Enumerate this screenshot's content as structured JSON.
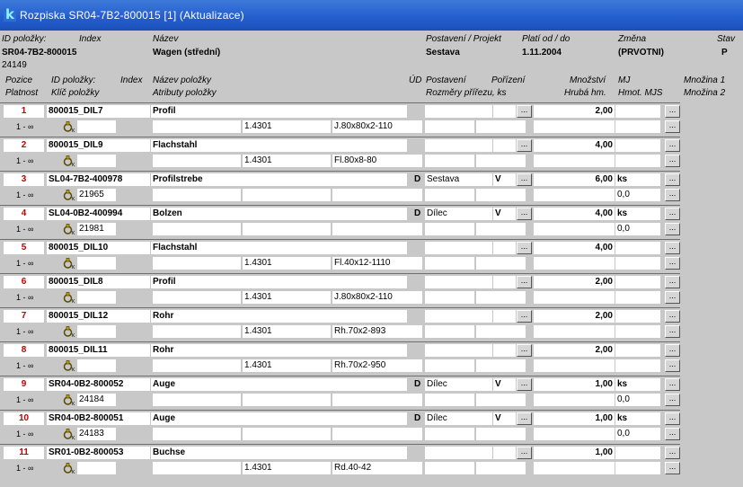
{
  "window": {
    "icon": "k",
    "title": "Rozpiska SR04-7B2-800015 [1] (Aktualizace)"
  },
  "header": {
    "labels": {
      "id": "ID položky:",
      "index": "Index",
      "name": "Název",
      "postaveni": "Postavení / Projekt",
      "platnost": "Platí od / do",
      "zmena": "Změna",
      "stav": "Stav"
    },
    "values": {
      "id": "SR04-7B2-800015",
      "num": "24149",
      "name": "Wagen (střední)",
      "postaveni": "Sestava",
      "date": "1.11.2004",
      "zmena": "(PRVOTNI)",
      "stav": "P"
    }
  },
  "columns": {
    "pozice": "Pozice",
    "platnost": "Platnost",
    "id": "ID položky:",
    "klic": "Klíč položky",
    "index": "Index",
    "nazev": "Název položky",
    "atributy": "Atributy položky",
    "ud": "ÚD",
    "postaveni": "Postavení",
    "rozmery": "Rozměry přířezu, ks",
    "porizeni": "Pořízení",
    "mnozstvi": "Množství",
    "hruba": "Hrubá hm.",
    "mj": "MJ",
    "hmot": "Hmot. MJS",
    "mnozina1": "Množina 1",
    "mnozina2": "Množina 2"
  },
  "button_label": "...",
  "items": [
    {
      "pos": "1",
      "validity": "1 - ∞",
      "id": "800015_DIL7",
      "name": "Profil",
      "ud": "",
      "postaveni": "",
      "porizeni": "",
      "qty": "2,00",
      "mj": "",
      "key": "",
      "material": "1.4301",
      "dim": "J.80x80x2-110",
      "hmot": ""
    },
    {
      "pos": "2",
      "validity": "1 - ∞",
      "id": "800015_DIL9",
      "name": "Flachstahl",
      "ud": "",
      "postaveni": "",
      "porizeni": "",
      "qty": "4,00",
      "mj": "",
      "key": "",
      "material": "1.4301",
      "dim": "Fl.80x8-80",
      "hmot": ""
    },
    {
      "pos": "3",
      "validity": "1 - ∞",
      "id": "SL04-7B2-400978",
      "name": "Profilstrebe",
      "ud": "D",
      "postaveni": "Sestava",
      "porizeni": "V",
      "qty": "6,00",
      "mj": "ks",
      "key": "21965",
      "material": "",
      "dim": "",
      "hmot": "0,0"
    },
    {
      "pos": "4",
      "validity": "1 - ∞",
      "id": "SL04-0B2-400994",
      "name": "Bolzen",
      "ud": "D",
      "postaveni": "Dílec",
      "porizeni": "V",
      "qty": "4,00",
      "mj": "ks",
      "key": "21981",
      "material": "",
      "dim": "",
      "hmot": "0,0"
    },
    {
      "pos": "5",
      "validity": "1 - ∞",
      "id": "800015_DIL10",
      "name": "Flachstahl",
      "ud": "",
      "postaveni": "",
      "porizeni": "",
      "qty": "4,00",
      "mj": "",
      "key": "",
      "material": "1.4301",
      "dim": "Fl.40x12-1110",
      "hmot": ""
    },
    {
      "pos": "6",
      "validity": "1 - ∞",
      "id": "800015_DIL8",
      "name": "Profil",
      "ud": "",
      "postaveni": "",
      "porizeni": "",
      "qty": "2,00",
      "mj": "",
      "key": "",
      "material": "1.4301",
      "dim": "J.80x80x2-110",
      "hmot": ""
    },
    {
      "pos": "7",
      "validity": "1 - ∞",
      "id": "800015_DIL12",
      "name": "Rohr",
      "ud": "",
      "postaveni": "",
      "porizeni": "",
      "qty": "2,00",
      "mj": "",
      "key": "",
      "material": "1.4301",
      "dim": "Rh.70x2-893",
      "hmot": ""
    },
    {
      "pos": "8",
      "validity": "1 - ∞",
      "id": "800015_DIL11",
      "name": "Rohr",
      "ud": "",
      "postaveni": "",
      "porizeni": "",
      "qty": "2,00",
      "mj": "",
      "key": "",
      "material": "1.4301",
      "dim": "Rh.70x2-950",
      "hmot": ""
    },
    {
      "pos": "9",
      "validity": "1 - ∞",
      "id": "SR04-0B2-800052",
      "name": "Auge",
      "ud": "D",
      "postaveni": "Dílec",
      "porizeni": "V",
      "qty": "1,00",
      "mj": "ks",
      "key": "24184",
      "material": "",
      "dim": "",
      "hmot": "0,0"
    },
    {
      "pos": "10",
      "validity": "1 - ∞",
      "id": "SR04-0B2-800051",
      "name": "Auge",
      "ud": "D",
      "postaveni": "Dílec",
      "porizeni": "V",
      "qty": "1,00",
      "mj": "ks",
      "key": "24183",
      "material": "",
      "dim": "",
      "hmot": "0,0"
    },
    {
      "pos": "11",
      "validity": "1 - ∞",
      "id": "SR01-0B2-800053",
      "name": "Buchse",
      "ud": "",
      "postaveni": "",
      "porizeni": "",
      "qty": "1,00",
      "mj": "",
      "key": "",
      "material": "1.4301",
      "dim": "Rd.40-42",
      "hmot": ""
    }
  ]
}
